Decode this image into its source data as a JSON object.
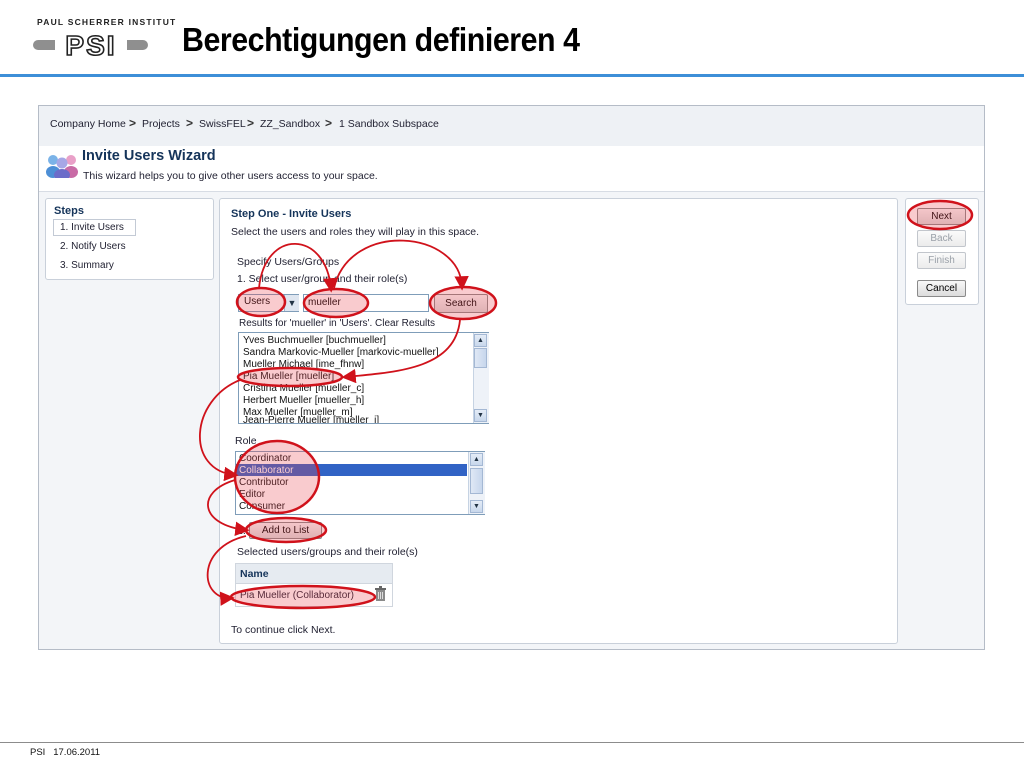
{
  "slide": {
    "title": "Berechtigungen definieren 4",
    "logo_top_text": "PAUL SCHERRER INSTITUT",
    "logo_text": "PSI",
    "footer_org": "PSI",
    "footer_date": "17.06.2011",
    "accent_color": "#3d8fd8",
    "annotation_color": "#d0121b"
  },
  "breadcrumb": {
    "items": [
      "Company Home",
      "Projects",
      "SwissFEL",
      "ZZ_Sandbox",
      "1 Sandbox Subspace"
    ],
    "separator": ">"
  },
  "wizard": {
    "icon": "users-group-icon",
    "title": "Invite Users Wizard",
    "description": "This wizard helps you to give other users access to your space."
  },
  "steps": {
    "title": "Steps",
    "items": [
      "1. Invite Users",
      "2. Notify Users",
      "3. Summary"
    ],
    "active_index": 0
  },
  "main": {
    "heading": "Step One - Invite Users",
    "intro": "Select the users and roles they will play in this space.",
    "specify_label": "Specify Users/Groups",
    "select_label": "1. Select user/group and their role(s)",
    "user_type_value": "Users",
    "search_value": "mueller",
    "search_button": "Search",
    "results_label": "Results for 'mueller' in 'Users'. Clear Results",
    "results": [
      "Yves Buchmueller [buchmueller]",
      "Sandra Markovic-Mueller [markovic-mueller]",
      "Mueller Michael [ime_fhnw]",
      "Pia Mueller [mueller]",
      "Cristina Mueller [mueller_c]",
      "Herbert Mueller [mueller_h]",
      "Max Mueller [mueller_m]",
      "Jean-Pierre Mueller [mueller_j]"
    ],
    "role_label": "Role",
    "roles": [
      "Coordinator",
      "Collaborator",
      "Contributor",
      "Editor",
      "Consumer"
    ],
    "selected_role_index": 1,
    "step2_prefix": "2.",
    "add_button": "Add to List",
    "selected_label": "Selected users/groups and their role(s)",
    "table_header": "Name",
    "selected_items": [
      "Pia Mueller (Collaborator)"
    ],
    "continue_text": "To continue click Next."
  },
  "nav": {
    "next": "Next",
    "back": "Back",
    "finish": "Finish",
    "cancel": "Cancel"
  }
}
